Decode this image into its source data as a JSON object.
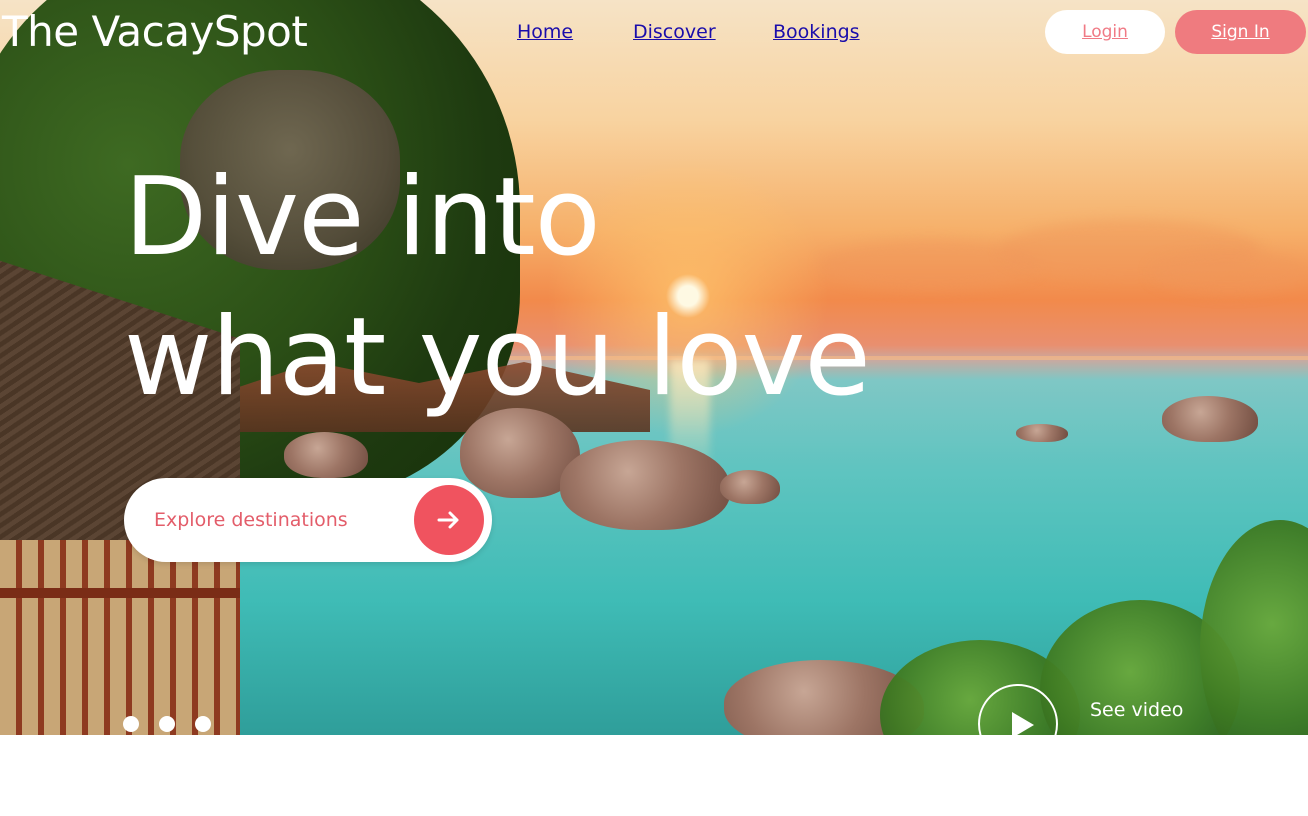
{
  "brand": {
    "name": "The VacaySpot"
  },
  "nav": {
    "links": [
      {
        "label": "Home"
      },
      {
        "label": "Discover"
      },
      {
        "label": "Bookings"
      }
    ],
    "login_label": "Login",
    "signin_label": "Sign In"
  },
  "hero": {
    "title_line1": "Dive into",
    "title_line2": "what you love",
    "cta_label": "Explore destinations",
    "cta_icon": "arrow-right-icon",
    "slides_count": 3,
    "video_label": "See video",
    "video_icon": "play-icon"
  },
  "colors": {
    "accent": "#f0535f",
    "signin_bg": "#ef7b7f",
    "link": "#1a0dab",
    "hero_text": "#ffffff"
  }
}
